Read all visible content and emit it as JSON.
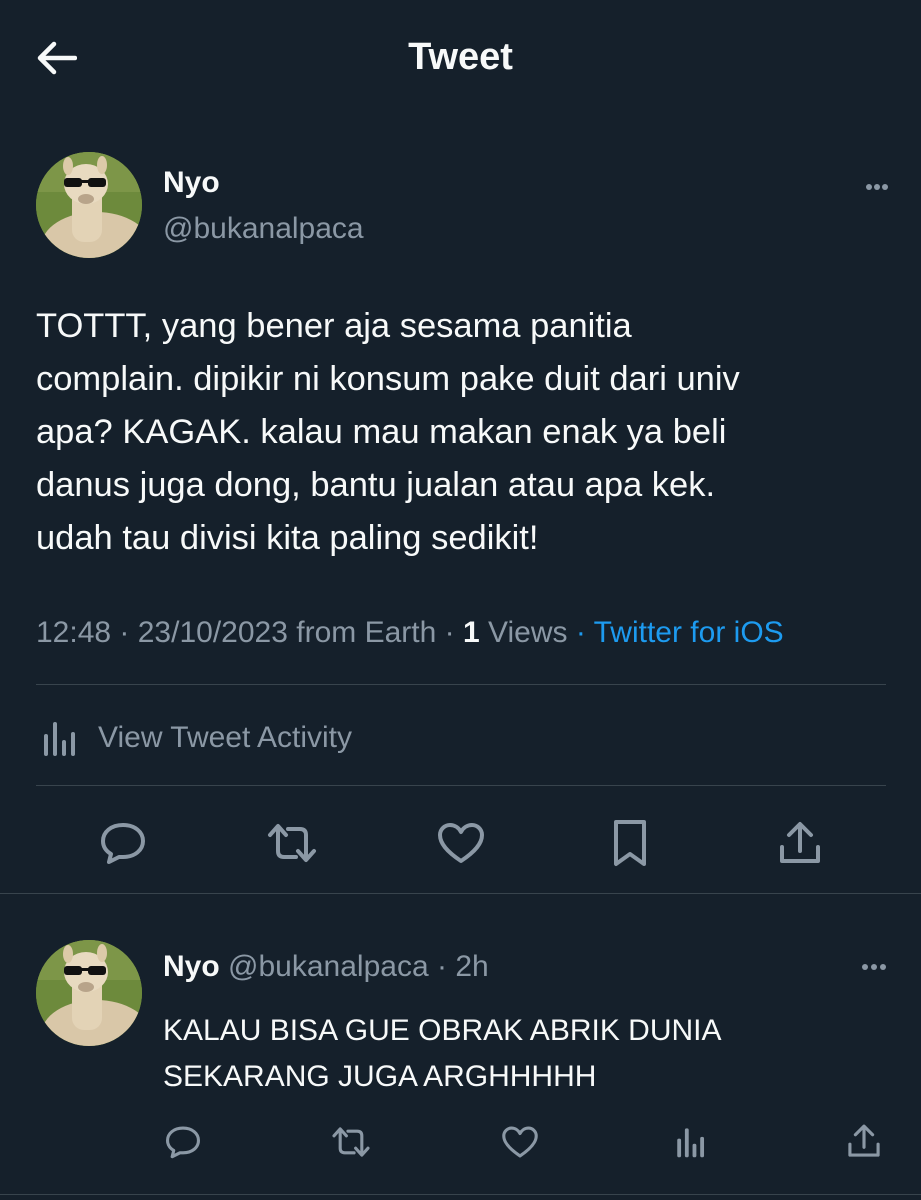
{
  "header": {
    "title": "Tweet",
    "back_icon": "arrow-left-icon"
  },
  "tweet": {
    "author_name": "Nyo",
    "author_handle": "@bukanalpaca",
    "text": "TOTTT, yang bener aja sesama panitia\ncomplain. dipikir ni konsum pake duit dari univ\napa? KAGAK. kalau mau makan enak ya beli\ndanus juga dong, bantu jualan atau apa kek.\nudah tau divisi kita paling sedikit!",
    "time": "12:48",
    "date": "23/10/2023",
    "location": "from Earth",
    "views_count": "1",
    "views_label": "Views",
    "source": "Twitter for iOS",
    "activity_label": "View Tweet Activity",
    "actions": [
      "reply-icon",
      "retweet-icon",
      "like-icon",
      "bookmark-icon",
      "share-icon"
    ]
  },
  "reply": {
    "author_name": "Nyo",
    "author_handle": "@bukanalpaca",
    "time_ago": "2h",
    "text": "KALAU BISA GUE OBRAK ABRIK DUNIA\nSEKARANG JUGA ARGHHHHH",
    "actions": [
      "reply-icon",
      "retweet-icon",
      "like-icon",
      "analytics-icon",
      "share-icon"
    ]
  },
  "colors": {
    "background": "#15202b",
    "text": "#f7f9f9",
    "secondary": "#8b98a5",
    "link": "#1d9bf0",
    "divider": "#38444d"
  }
}
